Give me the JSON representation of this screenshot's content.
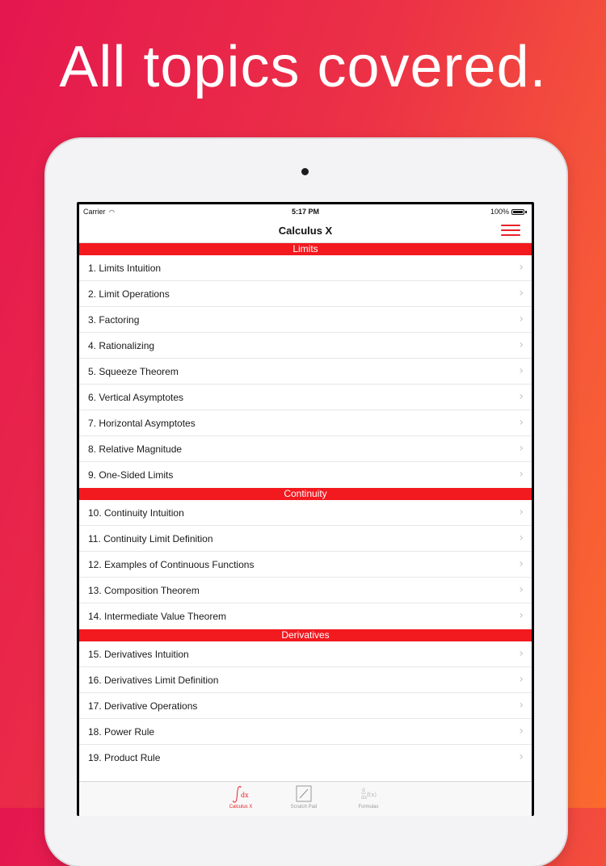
{
  "headline": "All topics covered.",
  "status_bar": {
    "carrier": "Carrier",
    "time": "5:17 PM",
    "battery": "100%"
  },
  "nav": {
    "title": "Calculus X",
    "menu_icon": "hamburger-menu-icon"
  },
  "colors": {
    "accent": "#f2191f",
    "chevron": "#c4c4c8"
  },
  "sections": [
    {
      "title": "Limits",
      "items": [
        "1. Limits Intuition",
        "2. Limit Operations",
        "3. Factoring",
        "4. Rationalizing",
        "5. Squeeze Theorem",
        "6. Vertical Asymptotes",
        "7. Horizontal Asymptotes",
        "8. Relative Magnitude",
        "9. One-Sided Limits"
      ]
    },
    {
      "title": "Continuity",
      "items": [
        "10. Continuity Intuition",
        "11. Continuity Limit Definition",
        "12. Examples of Continuous Functions",
        "13. Composition Theorem",
        "14. Intermediate Value Theorem"
      ]
    },
    {
      "title": "Derivatives",
      "items": [
        "15. Derivatives Intuition",
        "16. Derivatives Limit Definition",
        "17. Derivative Operations",
        "18. Power Rule",
        "19. Product Rule"
      ]
    }
  ],
  "tabs": [
    {
      "label": "Calculus X",
      "icon": "integral-icon",
      "active": true
    },
    {
      "label": "Scratch Pad",
      "icon": "scratch-pad-icon",
      "active": false
    },
    {
      "label": "Formulas",
      "icon": "derivative-formula-icon",
      "active": false
    }
  ]
}
